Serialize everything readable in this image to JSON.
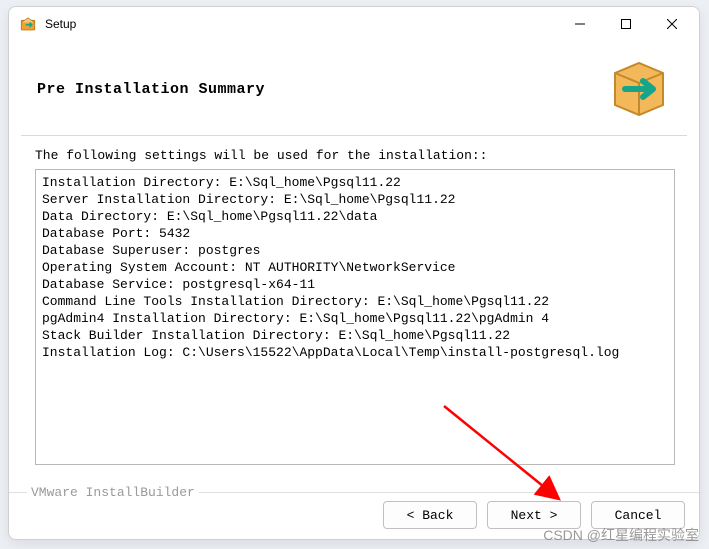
{
  "titlebar": {
    "title": "Setup"
  },
  "header": {
    "title": "Pre Installation Summary"
  },
  "content": {
    "intro": "The following settings will be used for the installation::",
    "summary_lines": [
      "Installation Directory: E:\\Sql_home\\Pgsql11.22",
      "Server Installation Directory: E:\\Sql_home\\Pgsql11.22",
      "Data Directory: E:\\Sql_home\\Pgsql11.22\\data",
      "Database Port: 5432",
      "Database Superuser: postgres",
      "Operating System Account: NT AUTHORITY\\NetworkService",
      "Database Service: postgresql-x64-11",
      "Command Line Tools Installation Directory: E:\\Sql_home\\Pgsql11.22",
      "pgAdmin4 Installation Directory: E:\\Sql_home\\Pgsql11.22\\pgAdmin 4",
      "Stack Builder Installation Directory: E:\\Sql_home\\Pgsql11.22",
      "Installation Log: C:\\Users\\15522\\AppData\\Local\\Temp\\install-postgresql.log"
    ]
  },
  "footer": {
    "builder": "VMware InstallBuilder",
    "back": "< Back",
    "next": "Next >",
    "cancel": "Cancel"
  },
  "watermark": "CSDN @红星编程实验室"
}
